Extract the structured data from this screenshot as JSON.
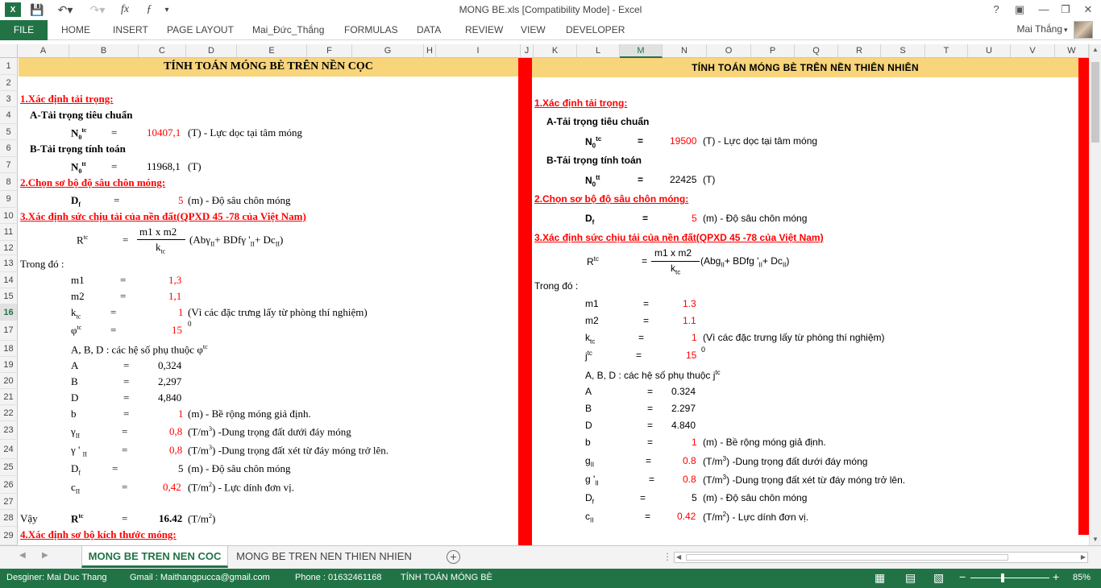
{
  "window": {
    "title": "MONG BE.xls  [Compatibility Mode] - Excel",
    "user": "Mai Thắng"
  },
  "ribbon": {
    "file": "FILE",
    "tabs": [
      "HOME",
      "INSERT",
      "PAGE LAYOUT",
      "Mai_Đức_Thắng",
      "FORMULAS",
      "DATA",
      "REVIEW",
      "VIEW",
      "DEVELOPER"
    ]
  },
  "columns": [
    "A",
    "B",
    "C",
    "D",
    "E",
    "F",
    "G",
    "H",
    "I",
    "J",
    "K",
    "L",
    "M",
    "N",
    "O",
    "P",
    "Q",
    "R",
    "S",
    "T",
    "U",
    "V",
    "W"
  ],
  "rows": [
    "1",
    "2",
    "3",
    "4",
    "5",
    "6",
    "7",
    "8",
    "9",
    "10",
    "11",
    "12",
    "13",
    "14",
    "15",
    "16",
    "17",
    "18",
    "19",
    "20",
    "21",
    "22",
    "23",
    "24",
    "25",
    "26",
    "27",
    "28",
    "29"
  ],
  "left": {
    "title": "TÍNH TOÁN MÓNG BÈ TRÊN NỀN CỌC",
    "h1": "1.Xác định tải trọng:",
    "a_label": "A-Tải trọng tiêu chuẩn",
    "n0": "N",
    "sub0": "0",
    "tc": "tc",
    "tt": "tt",
    "eq": "=",
    "ntc_val": "10407,1",
    "ntc_desc": "(T) - Lực dọc tại tâm móng",
    "b_label": "B-Tải trọng tính toán",
    "ntt_val": "11968,1",
    "unit_t": "(T)",
    "h2": "2.Chọn sơ bộ độ sâu chôn móng:",
    "df": "D",
    "f": "f",
    "df_val": "5",
    "df_desc": "(m) - Độ sâu chôn móng",
    "h3": "3.Xác định sức chịu tải của nền đất(QPXD 45 -78 của Việt Nam)",
    "rtc": "R",
    "num": "m1 x m2",
    "den": "k",
    "den_sub": "tc",
    "formula": "(Abγ",
    "formula_b": "+ BDfγ '",
    "formula_c": "+ Dc",
    "formula_end": ")",
    "ii": "II",
    "trong_do": "Trong đó :",
    "m1": "m1",
    "m1_val": "1,3",
    "m2": "m2",
    "m2_val": "1,1",
    "ktc": "k",
    "ktc_val": "1",
    "ktc_desc": "(Vì các đặc trưng lấy từ phòng thí nghiệm)",
    "phi": "φ",
    "phi_val": "15",
    "deg": "0",
    "abd": "A, B, D : các hệ số phụ thuộc φ",
    "A": "A",
    "A_val": "0,324",
    "B": "B",
    "B_val": "2,297",
    "D": "D",
    "D_val": "4,840",
    "b": "b",
    "b_val": "1",
    "b_desc": "(m) - Bề rộng móng giả định.",
    "g2": "γ",
    "g2_val": "0,8",
    "g2_desc": "(T/m",
    "g2_desc2": ") -Dung trọng đất dưới đáy móng",
    "g2p": "γ ' ",
    "g2p_val": "0,8",
    "g2p_desc2": ") -Dung trọng đất xét từ đáy móng trở lên.",
    "df2_val": "5",
    "c": "c",
    "c_val": "0,42",
    "c_desc": "(T/m",
    "c_desc2": ") - Lực dính đơn vị.",
    "three": "3",
    "two": "2",
    "vay": "Vậy",
    "r_val": "16.42",
    "r_unit": "(T/m",
    "h4": "4.Xác định sơ bộ kích thước móng:"
  },
  "right": {
    "title": "TÍNH TOÁN MÓNG BÈ TRÊN NỀN THIÊN NHIÊN",
    "h1": "1.Xác định tải trọng:",
    "a_label": "A-Tải trọng tiêu chuẩn",
    "ntc_val": "19500",
    "ntc_desc": "(T) - Lực dọc tại tâm móng",
    "b_label": "B-Tải trọng tính toán",
    "ntt_val": "22425",
    "h2": "2.Chọn sơ bộ độ sâu chôn móng:",
    "df_val": "5",
    "df_desc": "(m) - Độ sâu chôn móng",
    "h3": "3.Xác định sức chịu tải của nền đất(QPXD 45 -78 của Việt Nam)",
    "formula": "(Abg",
    "formula_b": "+ BDfg '",
    "formula_c": "+ Dc",
    "trong_do": "Trong đó :",
    "m1_val": "1.3",
    "m2_val": "1.1",
    "ktc_val": "1",
    "ktc_desc": "(Vì các đặc trưng lấy từ phòng thí nghiệm)",
    "j": "j",
    "j_val": "15",
    "abd": "A, B, D : các hệ số phụ thuộc j",
    "A_val": "0.324",
    "B_val": "2.297",
    "D_val": "4.840",
    "b_val": "1",
    "b_desc": "(m) - Bề rộng móng giả định.",
    "g": "g",
    "gp": "g '",
    "g_val": "0.8",
    "gp_val": "0.8",
    "df2_val": "5",
    "c_val": "0.42"
  },
  "sheets": {
    "tab1": "MONG BE TREN NEN COC",
    "tab2": "MONG BE TREN NEN THIEN NHIEN"
  },
  "status": {
    "designer": "Desginer: Mai Duc Thang",
    "gmail": "Gmail : Maithangpucca@gmail.com",
    "phone": "Phone : 01632461168",
    "sheet": "TÍNH TOÁN MÓNG BÈ",
    "zoom": "85%"
  }
}
